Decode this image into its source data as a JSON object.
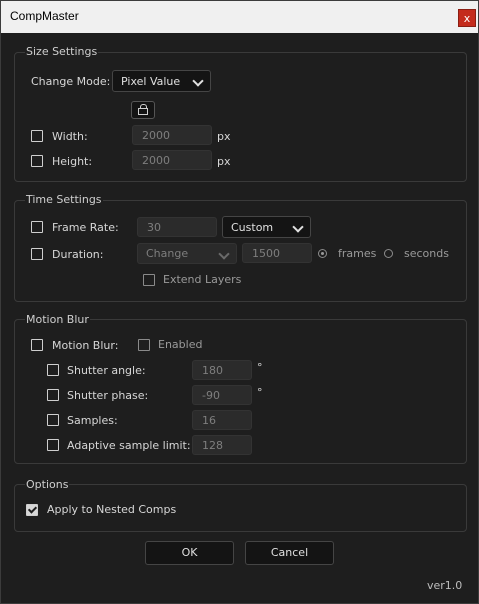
{
  "window": {
    "title": "CompMaster",
    "close_label": "x"
  },
  "size_settings": {
    "title": "Size Settings",
    "change_mode_label": "Change Mode:",
    "change_mode_value": "Pixel Value",
    "width_label": "Width:",
    "width_value": "2000",
    "height_label": "Height:",
    "height_value": "2000",
    "unit": "px"
  },
  "time_settings": {
    "title": "Time Settings",
    "frame_rate_label": "Frame Rate:",
    "frame_rate_value": "30",
    "frame_rate_preset": "Custom",
    "duration_label": "Duration:",
    "duration_mode": "Change",
    "duration_value": "1500",
    "unit_frames": "frames",
    "unit_seconds": "seconds",
    "extend_layers_label": "Extend Layers"
  },
  "motion_blur": {
    "title": "Motion Blur",
    "motion_blur_label": "Motion Blur:",
    "enabled_label": "Enabled",
    "shutter_angle_label": "Shutter angle:",
    "shutter_angle_value": "180",
    "shutter_phase_label": "Shutter phase:",
    "shutter_phase_value": "-90",
    "degree_symbol": "°",
    "samples_label": "Samples:",
    "samples_value": "16",
    "adaptive_label": "Adaptive sample limit:",
    "adaptive_value": "128"
  },
  "options": {
    "title": "Options",
    "apply_nested_label": "Apply to Nested Comps",
    "apply_nested_checked": true
  },
  "buttons": {
    "ok": "OK",
    "cancel": "Cancel"
  },
  "version": "ver1.0"
}
